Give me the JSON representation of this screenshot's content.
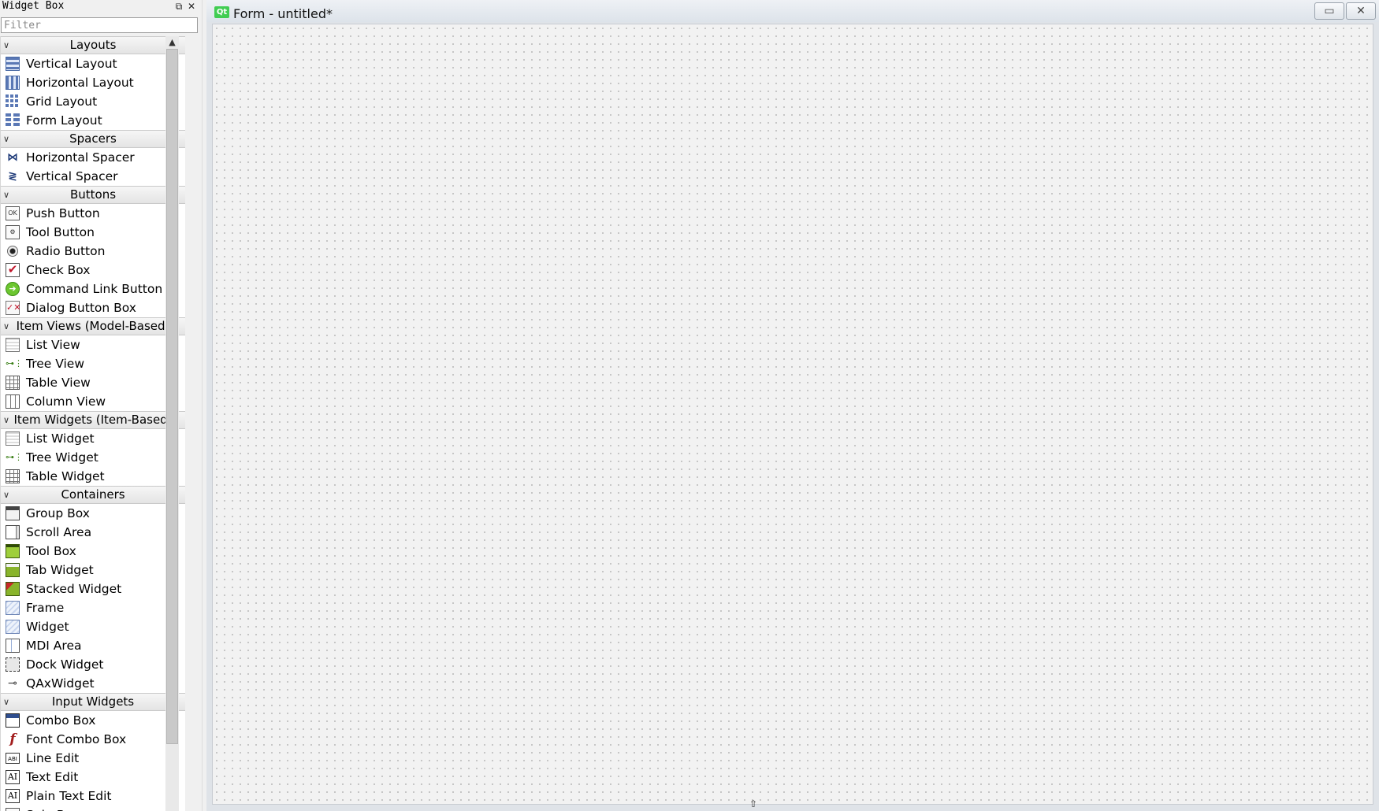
{
  "widget_box": {
    "title": "Widget Box",
    "float_icon": "⧉",
    "close_icon": "✕",
    "filter_placeholder": "Filter",
    "categories": [
      {
        "name": "Layouts",
        "items": [
          {
            "label": "Vertical Layout",
            "icon": "vertical-layout-icon"
          },
          {
            "label": "Horizontal Layout",
            "icon": "horizontal-layout-icon"
          },
          {
            "label": "Grid Layout",
            "icon": "grid-layout-icon"
          },
          {
            "label": "Form Layout",
            "icon": "form-layout-icon"
          }
        ]
      },
      {
        "name": "Spacers",
        "items": [
          {
            "label": "Horizontal Spacer",
            "icon": "horizontal-spacer-icon"
          },
          {
            "label": "Vertical Spacer",
            "icon": "vertical-spacer-icon"
          }
        ]
      },
      {
        "name": "Buttons",
        "items": [
          {
            "label": "Push Button",
            "icon": "push-button-icon"
          },
          {
            "label": "Tool Button",
            "icon": "tool-button-icon"
          },
          {
            "label": "Radio Button",
            "icon": "radio-button-icon"
          },
          {
            "label": "Check Box",
            "icon": "check-box-icon"
          },
          {
            "label": "Command Link Button",
            "icon": "command-link-icon"
          },
          {
            "label": "Dialog Button Box",
            "icon": "dialog-button-box-icon"
          }
        ]
      },
      {
        "name": "Item Views (Model-Based)",
        "items": [
          {
            "label": "List View",
            "icon": "list-view-icon"
          },
          {
            "label": "Tree View",
            "icon": "tree-view-icon"
          },
          {
            "label": "Table View",
            "icon": "table-view-icon"
          },
          {
            "label": "Column View",
            "icon": "column-view-icon"
          }
        ]
      },
      {
        "name": "Item Widgets (Item-Based)",
        "items": [
          {
            "label": "List Widget",
            "icon": "list-widget-icon"
          },
          {
            "label": "Tree Widget",
            "icon": "tree-widget-icon"
          },
          {
            "label": "Table Widget",
            "icon": "table-widget-icon"
          }
        ]
      },
      {
        "name": "Containers",
        "items": [
          {
            "label": "Group Box",
            "icon": "group-box-icon"
          },
          {
            "label": "Scroll Area",
            "icon": "scroll-area-icon"
          },
          {
            "label": "Tool Box",
            "icon": "tool-box-icon"
          },
          {
            "label": "Tab Widget",
            "icon": "tab-widget-icon"
          },
          {
            "label": "Stacked Widget",
            "icon": "stacked-widget-icon"
          },
          {
            "label": "Frame",
            "icon": "frame-icon"
          },
          {
            "label": "Widget",
            "icon": "widget-icon"
          },
          {
            "label": "MDI Area",
            "icon": "mdi-area-icon"
          },
          {
            "label": "Dock Widget",
            "icon": "dock-widget-icon"
          },
          {
            "label": "QAxWidget",
            "icon": "qaxwidget-icon"
          }
        ]
      },
      {
        "name": "Input Widgets",
        "items": [
          {
            "label": "Combo Box",
            "icon": "combo-box-icon"
          },
          {
            "label": "Font Combo Box",
            "icon": "font-combo-box-icon"
          },
          {
            "label": "Line Edit",
            "icon": "line-edit-icon"
          },
          {
            "label": "Text Edit",
            "icon": "text-edit-icon"
          },
          {
            "label": "Plain Text Edit",
            "icon": "plain-text-edit-icon"
          },
          {
            "label": "Spin Box",
            "icon": "spin-box-icon"
          }
        ]
      }
    ]
  },
  "form": {
    "logo_text": "Qt",
    "title": "Form - untitled*",
    "minimize_glyph": "▭",
    "close_glyph": "✕"
  },
  "icon_glyphs": {
    "push-button-icon": "OK",
    "tool-button-icon": "⚙",
    "check-box-icon": "✔",
    "command-link-icon": "➔",
    "dialog-button-box-icon": "✓✕",
    "tree-view-icon": "⊶⋮",
    "tree-widget-icon": "⊶⋮",
    "horizontal-spacer-icon": "⋈",
    "vertical-spacer-icon": "≷",
    "qaxwidget-icon": "⊸",
    "font-combo-box-icon": "f",
    "line-edit-icon": "ABI",
    "text-edit-icon": "AI",
    "plain-text-edit-icon": "AI"
  }
}
